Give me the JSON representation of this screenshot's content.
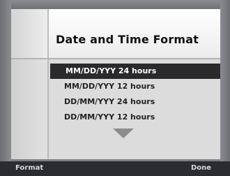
{
  "header": {
    "title": "Date and Time Format"
  },
  "format_options": [
    {
      "label": "MM/DD/YYY 24 hours",
      "selected": true
    },
    {
      "label": "MM/DD/YYY 12 hours",
      "selected": false
    },
    {
      "label": "DD/MM/YYY 24 hours",
      "selected": false
    },
    {
      "label": "DD/MM/YYY 12 hours",
      "selected": false
    }
  ],
  "scroll_indicator": {
    "icon": "down-triangle-icon"
  },
  "softkeys": {
    "left_label": "Format",
    "right_label": "Done"
  }
}
